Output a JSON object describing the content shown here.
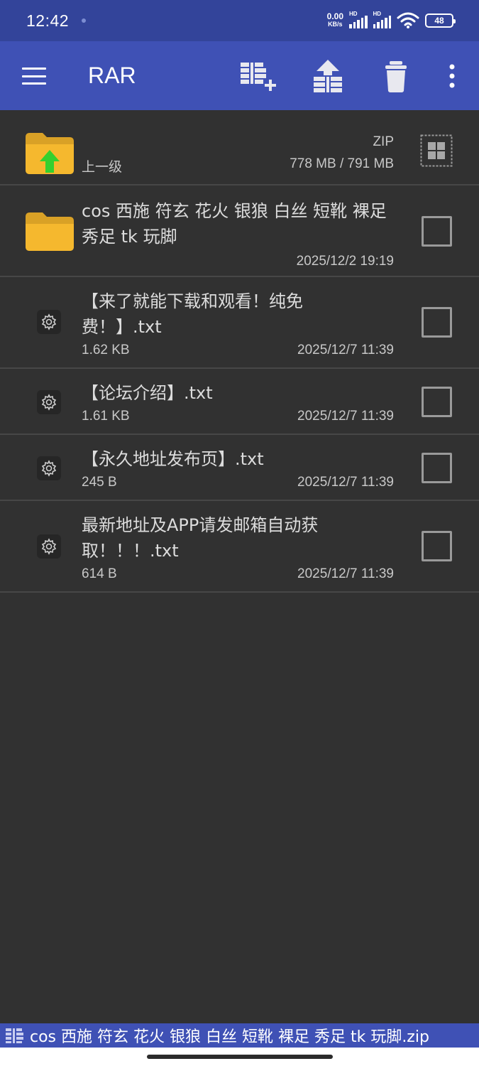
{
  "status_bar": {
    "time": "12:42",
    "net_speed_value": "0.00",
    "net_speed_unit": "KB/s",
    "signal_1_label": "HD",
    "signal_2_label": "HD",
    "battery": "48"
  },
  "app_bar": {
    "title": "RAR",
    "icons": [
      "menu-icon",
      "add-to-archive-icon",
      "extract-icon",
      "delete-icon",
      "more-vert-icon"
    ]
  },
  "parent_row": {
    "label": "上一级",
    "archive_type": "ZIP",
    "size": "778 MB / 791 MB"
  },
  "items": [
    {
      "type": "folder",
      "name": "cos 西施 符玄 花火 银狼 白丝 短靴 裸足 秀足 tk 玩脚",
      "size": "",
      "date": "2025/12/2 19:19"
    },
    {
      "type": "file",
      "name": "【来了就能下载和观看！纯免费！】.txt",
      "size": "1.62 KB",
      "date": "2025/12/7 11:39"
    },
    {
      "type": "file",
      "name": "【论坛介绍】.txt",
      "size": "1.61 KB",
      "date": "2025/12/7 11:39"
    },
    {
      "type": "file",
      "name": "【永久地址发布页】.txt",
      "size": "245 B",
      "date": "2025/12/7 11:39"
    },
    {
      "type": "file",
      "name": "最新地址及APP请发邮箱自动获取！！！.txt",
      "size": "614 B",
      "date": "2025/12/7 11:39"
    }
  ],
  "bottom_bar": {
    "archive_name": "cos 西施 符玄 花火 银狼 白丝 短靴 裸足 秀足 tk 玩脚.zip"
  },
  "colors": {
    "status_bar": "#33449a",
    "app_bar": "#3f51b5",
    "background": "#313131",
    "divider": "#474747",
    "folder": "#f5b82e",
    "up_arrow": "#35d02e"
  }
}
